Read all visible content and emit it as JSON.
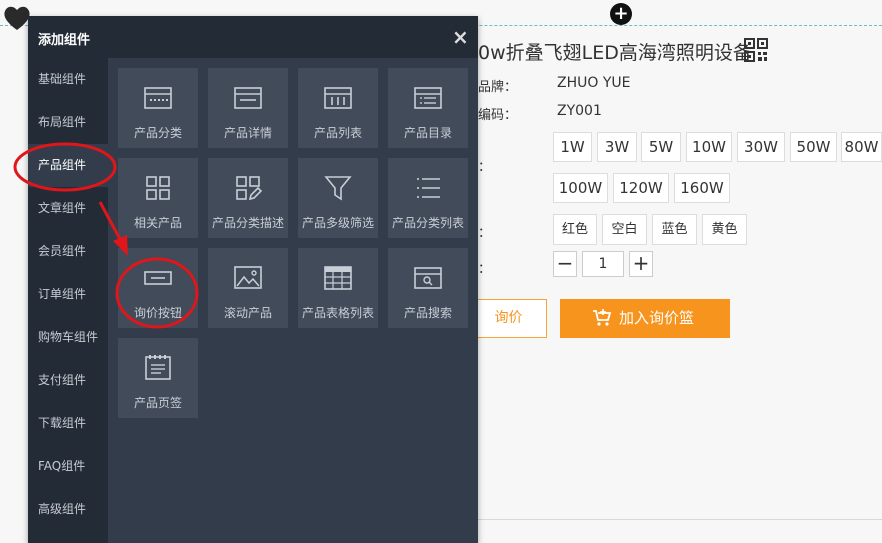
{
  "page": {
    "title": "0w折叠飞翅LED高海湾照明设备",
    "attributes": [
      {
        "label": "品牌：",
        "value": "ZHUO YUE"
      },
      {
        "label": "编码：",
        "value": "ZY001"
      }
    ],
    "power_label": "：",
    "power_options": [
      "1W",
      "3W",
      "5W",
      "10W",
      "30W",
      "50W",
      "80W",
      "100W",
      "120W",
      "160W"
    ],
    "color_label": "：",
    "color_options": [
      "红色",
      "空白",
      "蓝色",
      "黄色"
    ],
    "qty_label": "：",
    "qty_minus": "−",
    "qty_value": "1",
    "qty_plus": "+",
    "inquiry_button": "询价",
    "cart_button": "加入询价篮",
    "add_marker": "+"
  },
  "panel": {
    "title": "添加组件",
    "close": "×",
    "categories": [
      "基础组件",
      "布局组件",
      "产品组件",
      "文章组件",
      "会员组件",
      "订单组件",
      "购物车组件",
      "支付组件",
      "下载组件",
      "FAQ组件",
      "高级组件"
    ],
    "active_category": "产品组件",
    "tiles": [
      {
        "label": "产品分类",
        "icon": "category-icon"
      },
      {
        "label": "产品详情",
        "icon": "detail-icon"
      },
      {
        "label": "产品列表",
        "icon": "list-icon"
      },
      {
        "label": "产品目录",
        "icon": "catalog-icon"
      },
      {
        "label": "相关产品",
        "icon": "grid-icon"
      },
      {
        "label": "产品分类描述",
        "icon": "grid-edit-icon"
      },
      {
        "label": "产品多级筛选",
        "icon": "filter-icon"
      },
      {
        "label": "产品分类列表",
        "icon": "bullet-list-icon"
      },
      {
        "label": "询价按钮",
        "icon": "button-icon"
      },
      {
        "label": "滚动产品",
        "icon": "image-icon"
      },
      {
        "label": "产品表格列表",
        "icon": "table-icon"
      },
      {
        "label": "产品搜索",
        "icon": "search-box-icon"
      },
      {
        "label": "产品页签",
        "icon": "page-tab-icon"
      }
    ]
  },
  "colors": {
    "accent_orange": "#f7941d",
    "annotation_red": "#e0161b",
    "panel_bg": "#323c4b",
    "panel_dark": "#232b37"
  }
}
